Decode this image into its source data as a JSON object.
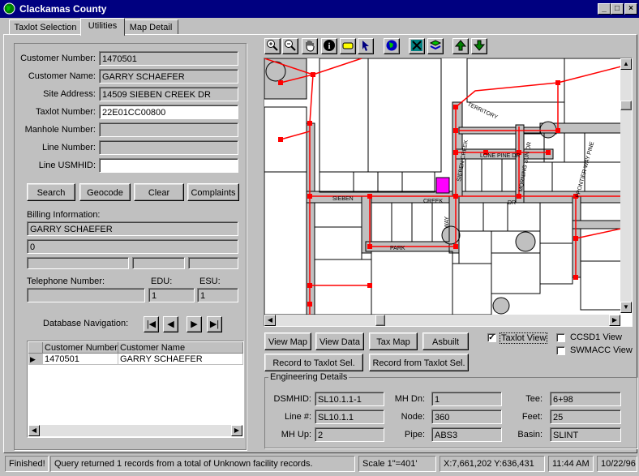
{
  "window": {
    "title": "Clackamas County",
    "min": "_",
    "max": "□",
    "close": "×"
  },
  "tabs": [
    "Taxlot Selection",
    "Utilities",
    "Map Detail"
  ],
  "form": {
    "customer_number": {
      "label": "Customer Number:",
      "value": "1470501"
    },
    "customer_name": {
      "label": "Customer Name:",
      "value": "GARRY SCHAEFER"
    },
    "site_address": {
      "label": "Site Address:",
      "value": "14509 SIEBEN CREEK DR"
    },
    "taxlot_number": {
      "label": "Taxlot Number:",
      "value": "22E01CC00800"
    },
    "manhole_number": {
      "label": "Manhole Number:",
      "value": ""
    },
    "line_number": {
      "label": "Line Number:",
      "value": ""
    },
    "line_usmhid": {
      "label": "Line USMHID:",
      "value": ""
    }
  },
  "buttons": {
    "search": "Search",
    "geocode": "Geocode",
    "clear": "Clear",
    "complaints": "Complaints"
  },
  "billing": {
    "label": "Billing Information:",
    "name": "GARRY SCHAEFER",
    "line2": "0"
  },
  "telephone": {
    "label": "Telephone Number:",
    "value": ""
  },
  "edu": {
    "label": "EDU:",
    "value": "1"
  },
  "esu": {
    "label": "ESU:",
    "value": "1"
  },
  "nav": {
    "label": "Database Navigation:",
    "first": "|◀",
    "prev": "◀",
    "next": "▶",
    "last": "▶|"
  },
  "grid": {
    "columns": [
      "Customer Number",
      "Customer Name"
    ],
    "rows": [
      {
        "number": "1470501",
        "name": "GARRY SCHAEFER"
      }
    ]
  },
  "map": {
    "streets": [
      "SIEBEN",
      "CREEK",
      "DR",
      "PARK",
      "WAY",
      "TERRITORY",
      "LONE PINE DR",
      "MORNING SUN DR",
      "FRONTIER WAY PINE",
      "SIEBEN CREEK"
    ],
    "colors": {
      "background": "#ffffff",
      "parcel": "#000000",
      "street_fill": "#c0c0c0",
      "sewer_line": "#ff0000",
      "selected_parcel": "#ff00ff"
    }
  },
  "map_buttons": {
    "view_map": "View Map",
    "view_data": "View Data",
    "tax_map": "Tax Map",
    "asbuilt": "Asbuilt",
    "record_to": "Record to Taxlot Sel.",
    "record_from": "Record from Taxlot Sel."
  },
  "views": {
    "taxlot": {
      "label": "Taxlot View",
      "checked": true
    },
    "ccsd1": {
      "label": "CCSD1 View",
      "checked": false
    },
    "swmacc": {
      "label": "SWMACC View",
      "checked": false
    }
  },
  "engineering": {
    "title": "Engineering Details",
    "dsmhid": {
      "label": "DSMHID:",
      "value": "SL10.1.1-1"
    },
    "line_num": {
      "label": "Line #:",
      "value": "SL10.1.1"
    },
    "mh_up": {
      "label": "MH Up:",
      "value": "2"
    },
    "mh_dn": {
      "label": "MH Dn:",
      "value": "1"
    },
    "node": {
      "label": "Node:",
      "value": "360"
    },
    "pipe": {
      "label": "Pipe:",
      "value": "ABS3"
    },
    "tee": {
      "label": "Tee:",
      "value": "6+98"
    },
    "feet": {
      "label": "Feet:",
      "value": "25"
    },
    "basin": {
      "label": "Basin:",
      "value": "SLINT"
    }
  },
  "status": {
    "state": "Finished!",
    "message": "Query returned 1 records from a total of Unknown facility records.",
    "scale": "Scale 1\"=401'",
    "coords": "X:7,661,202  Y:636,431",
    "time": "11:44 AM",
    "date": "10/22/96"
  }
}
